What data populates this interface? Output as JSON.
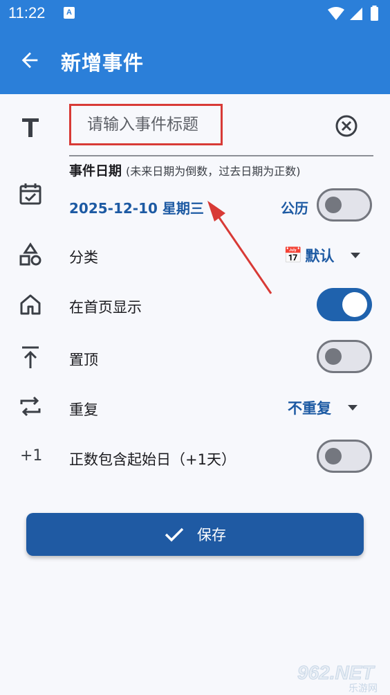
{
  "status_bar": {
    "time": "11:22",
    "notification_icon": "A"
  },
  "app_bar": {
    "title": "新增事件",
    "back_icon": "arrow-left-icon"
  },
  "event_title": {
    "placeholder": "请输入事件标题"
  },
  "date_section": {
    "label": "事件日期",
    "hint": "(未来日期为倒数，过去日期为正数)",
    "value": "2025-12-10 星期三",
    "calendar_mode_label": "公历",
    "calendar_mode_on": false
  },
  "category": {
    "label": "分类",
    "emoji": "📅",
    "value": "默认"
  },
  "show_on_home": {
    "label": "在首页显示",
    "on": true
  },
  "pin_top": {
    "label": "置顶",
    "on": false
  },
  "repeat": {
    "label": "重复",
    "value": "不重复"
  },
  "plus_one": {
    "icon_text": "+1",
    "label": "正数包含起始日（+1天）",
    "on": false
  },
  "save_button": {
    "label": "保存"
  },
  "watermark": {
    "logo": "962.NET",
    "text": "乐游网"
  },
  "colors": {
    "primary": "#2b7fd9",
    "dark_primary": "#1f5aa3",
    "accent_red": "#d83a36"
  }
}
